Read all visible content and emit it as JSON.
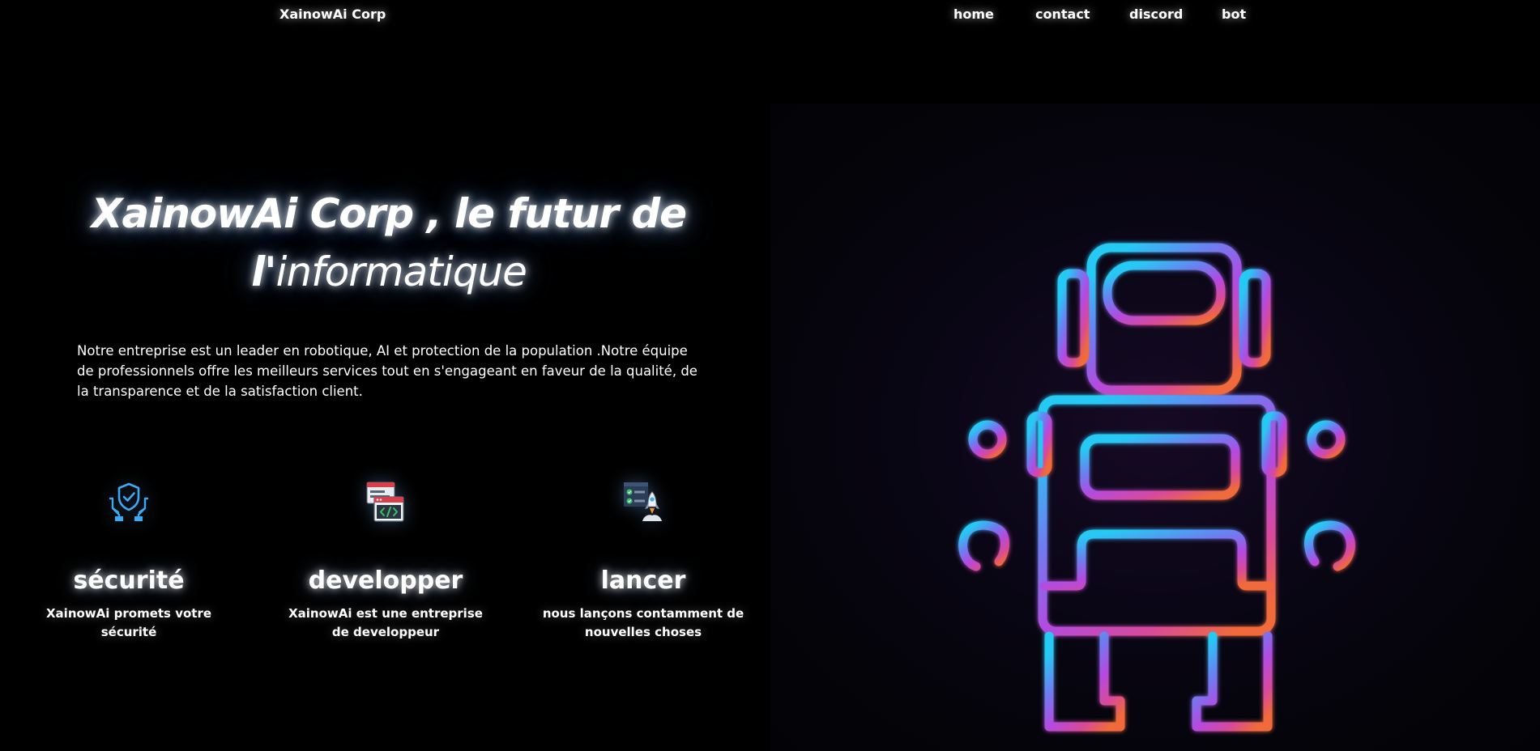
{
  "nav": {
    "brand": "XainowAi Corp",
    "links": [
      "home",
      "contact",
      "discord",
      "bot"
    ]
  },
  "hero": {
    "title_line1": "XainowAi Corp , le futur de",
    "title_line2_strong": "l'",
    "title_line2_rest": "informatique",
    "intro": "Notre entreprise est un leader en robotique, AI et protection de la population .Notre équipe de professionnels offre les meilleurs services tout en s'engageant en faveur de la qualité, de la transparence et de la satisfaction client."
  },
  "features": [
    {
      "icon": "shield-hands-icon",
      "title": "sécurité",
      "description": "XainowAi promets votre sécurité"
    },
    {
      "icon": "code-window-icon",
      "title": "developper",
      "description": "XainowAi est une entreprise de developpeur"
    },
    {
      "icon": "rocket-launch-icon",
      "title": "lancer",
      "description": "nous lançons contamment de nouvelles choses"
    }
  ],
  "illustration": {
    "icon": "robot-icon"
  },
  "colors": {
    "background": "#000000",
    "text": "#ffffff",
    "robot_gradient": [
      "#28c8f4",
      "#6e7cf0",
      "#b34be0",
      "#d84a9a",
      "#f06a3a"
    ],
    "icon_blue": "#3ea8f0"
  }
}
